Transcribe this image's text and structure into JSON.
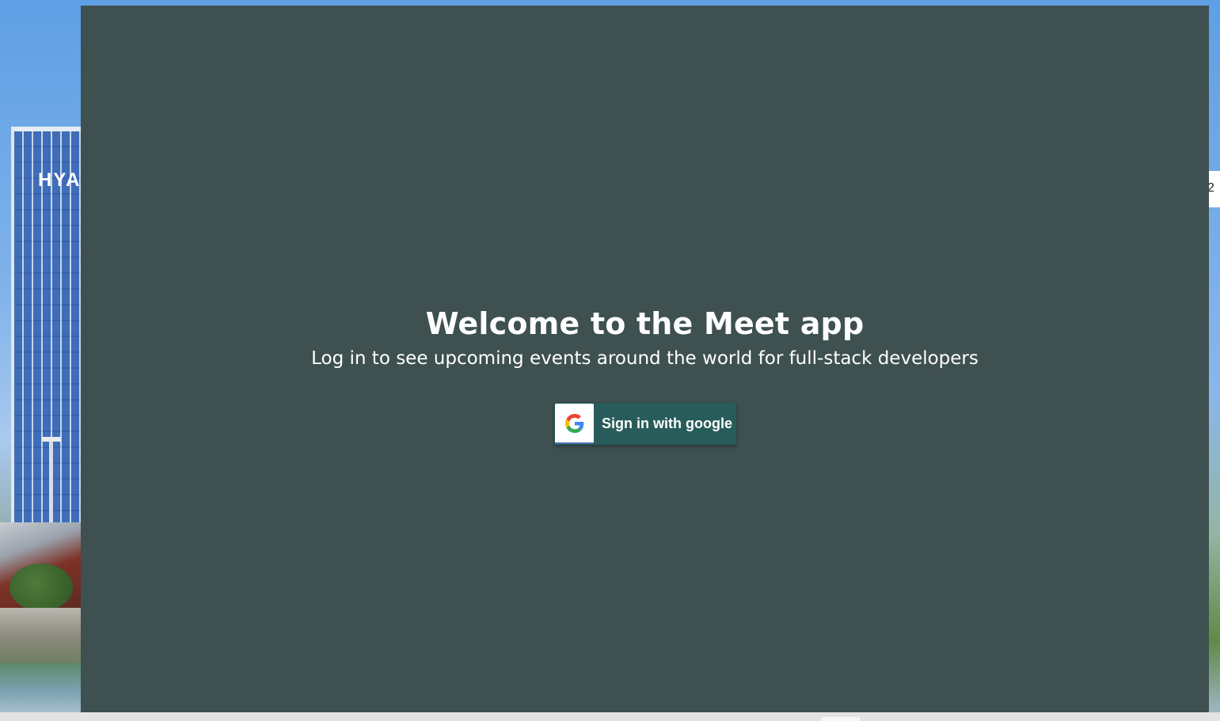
{
  "login": {
    "title": "Welcome to the Meet app",
    "subtitle": "Log in to see upcoming events around the world for full-stack developers",
    "google_button_label": "Sign in with google",
    "google_icon": "google-g-icon"
  },
  "background": {
    "sign_text": "HYA",
    "side_chip_text": "2"
  },
  "colors": {
    "overlay": "#3e5050",
    "button": "#285c5a",
    "text": "#ffffff"
  }
}
